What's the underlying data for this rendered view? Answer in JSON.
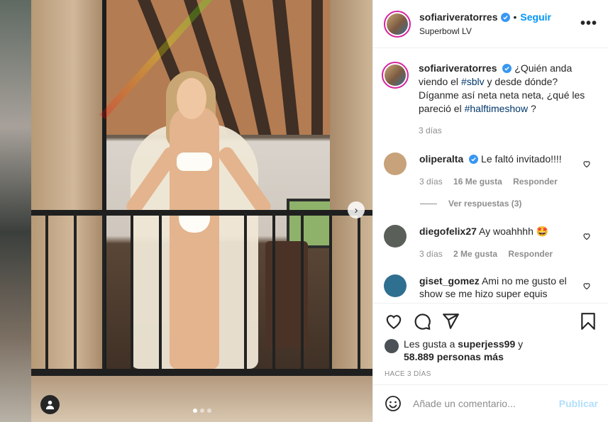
{
  "post": {
    "author": "sofiariveratorres",
    "follow_label": "Seguir",
    "separator": "•",
    "location": "Superbowl LV",
    "more_label": "•••",
    "caption_parts": [
      "¿Quién anda viendo el ",
      "#sblv",
      " y desde dónde? Díganme así neta neta neta, ¿qué les pareció el ",
      "#halftimeshow",
      " ?"
    ],
    "caption_age": "3 días"
  },
  "comments": [
    {
      "user": "oliperalta",
      "verified": true,
      "text": "Le faltó invitado!!!!",
      "age": "3 días",
      "likes": "16 Me gusta",
      "reply": "Responder",
      "avatar_color": "#c7a27a",
      "view_replies": "Ver respuestas (3)"
    },
    {
      "user": "diegofelix27",
      "verified": false,
      "text": "Ay woahhhh 🤩",
      "age": "3 días",
      "likes": "2 Me gusta",
      "reply": "Responder",
      "avatar_color": "#5b5f5a"
    },
    {
      "user": "giset_gomez",
      "verified": false,
      "text": "Ami no me gusto el show se me hizo super equis",
      "avatar_color": "#2f6f8f"
    }
  ],
  "likes": {
    "prefix": "Les gusta a ",
    "user": "superjess99",
    "middle": " y",
    "count": "58.889 personas más"
  },
  "time_ago": "HACE 3 DÍAS",
  "comment_box": {
    "placeholder": "Añade un comentario...",
    "post_label": "Publicar"
  },
  "carousel": {
    "next_label": "›",
    "slide_count": 3,
    "active_index": 0
  },
  "colors": {
    "accent": "#0095f6",
    "verified": "#3897f0",
    "hashtag": "#00376b",
    "muted": "#8e8e8e",
    "post_disabled": "#b2dffc"
  }
}
